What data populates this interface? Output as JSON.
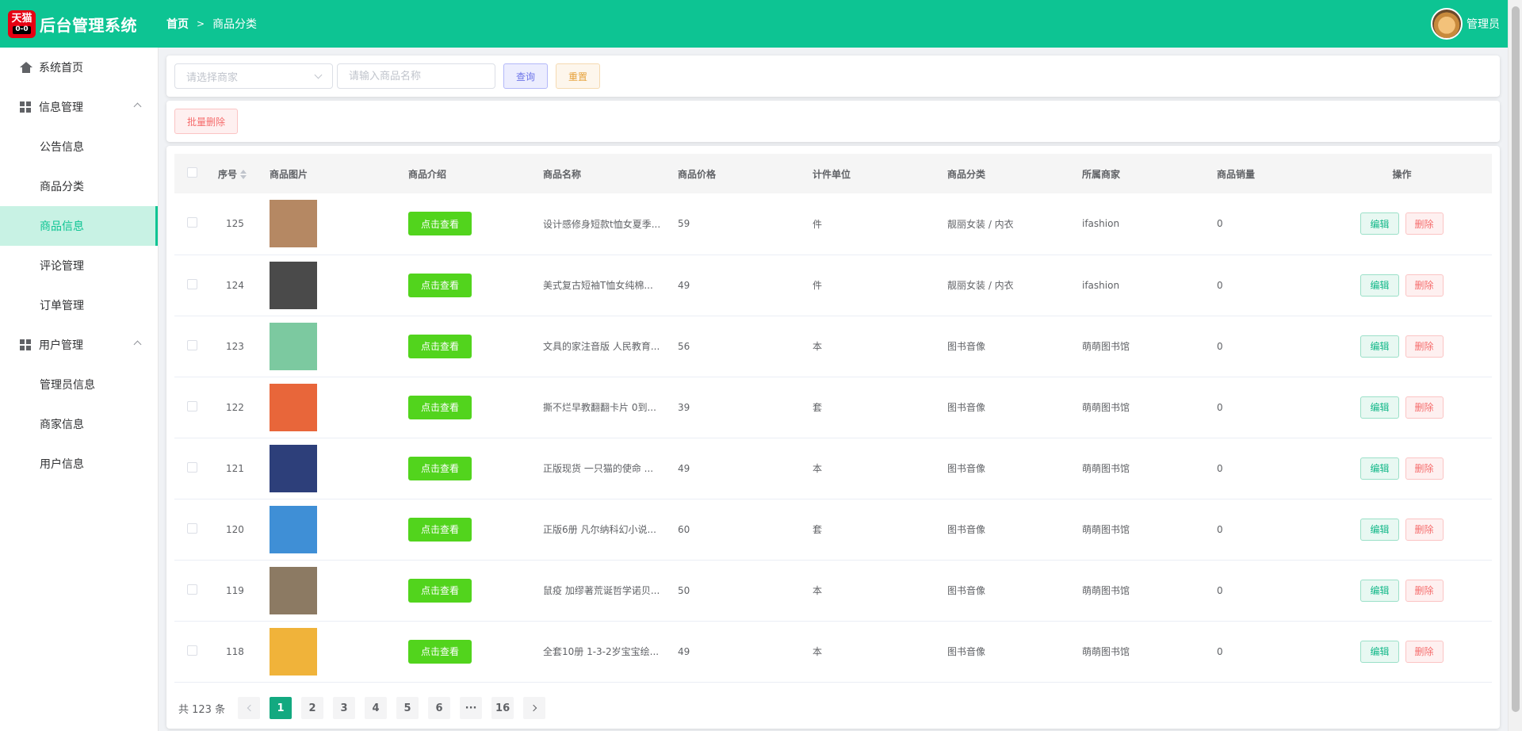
{
  "header": {
    "logo_top": "天猫",
    "logo_face": "0-0",
    "title": "后台管理系统",
    "breadcrumb": [
      "首页",
      "商品分类"
    ],
    "user_name": "管理员"
  },
  "sidebar": {
    "home": "系统首页",
    "group1": "信息管理",
    "group1_items": [
      "公告信息",
      "商品分类",
      "商品信息",
      "评论管理",
      "订单管理"
    ],
    "group2": "用户管理",
    "group2_items": [
      "管理员信息",
      "商家信息",
      "用户信息"
    ],
    "active_item": "商品信息"
  },
  "search": {
    "merchant_placeholder": "请选择商家",
    "name_placeholder": "请输入商品名称",
    "query_label": "查询",
    "reset_label": "重置"
  },
  "ops": {
    "batch_delete_label": "批量删除"
  },
  "table": {
    "headers": [
      "序号",
      "商品图片",
      "商品介绍",
      "商品名称",
      "商品价格",
      "计件单位",
      "商品分类",
      "所属商家",
      "商品销量",
      "操作"
    ],
    "view_label": "点击查看",
    "edit_label": "编辑",
    "delete_label": "删除",
    "rows": [
      {
        "id": "125",
        "name": "设计感修身短款t恤女夏季...",
        "price": "59",
        "unit": "件",
        "category": "靓丽女装 / 内衣",
        "merchant": "ifashion",
        "sales": "0",
        "img_color": "#b58863"
      },
      {
        "id": "124",
        "name": "美式复古短袖T恤女纯棉...",
        "price": "49",
        "unit": "件",
        "category": "靓丽女装 / 内衣",
        "merchant": "ifashion",
        "sales": "0",
        "img_color": "#4a4a4a"
      },
      {
        "id": "123",
        "name": "文具的家注音版 人民教育...",
        "price": "56",
        "unit": "本",
        "category": "图书音像",
        "merchant": "萌萌图书馆",
        "sales": "0",
        "img_color": "#7cc9a0"
      },
      {
        "id": "122",
        "name": "撕不烂早教翻翻卡片 0到...",
        "price": "39",
        "unit": "套",
        "category": "图书音像",
        "merchant": "萌萌图书馆",
        "sales": "0",
        "img_color": "#e8663a"
      },
      {
        "id": "121",
        "name": "正版现货 一只猫的使命 ...",
        "price": "49",
        "unit": "本",
        "category": "图书音像",
        "merchant": "萌萌图书馆",
        "sales": "0",
        "img_color": "#2d3f7a"
      },
      {
        "id": "120",
        "name": "正版6册 凡尔纳科幻小说...",
        "price": "60",
        "unit": "套",
        "category": "图书音像",
        "merchant": "萌萌图书馆",
        "sales": "0",
        "img_color": "#3f8fd6"
      },
      {
        "id": "119",
        "name": "鼠疫 加缪著荒诞哲学诺贝...",
        "price": "50",
        "unit": "本",
        "category": "图书音像",
        "merchant": "萌萌图书馆",
        "sales": "0",
        "img_color": "#8c7a63"
      },
      {
        "id": "118",
        "name": "全套10册 1-3-2岁宝宝绘...",
        "price": "49",
        "unit": "本",
        "category": "图书音像",
        "merchant": "萌萌图书馆",
        "sales": "0",
        "img_color": "#f0b33a"
      }
    ]
  },
  "pagination": {
    "total_text": "共 123 条",
    "pages": [
      "1",
      "2",
      "3",
      "4",
      "5",
      "6",
      "···",
      "16"
    ],
    "current": "1"
  },
  "colors": {
    "primary": "#0dc493",
    "view_button": "#52d41d",
    "active_page": "#13a980"
  }
}
